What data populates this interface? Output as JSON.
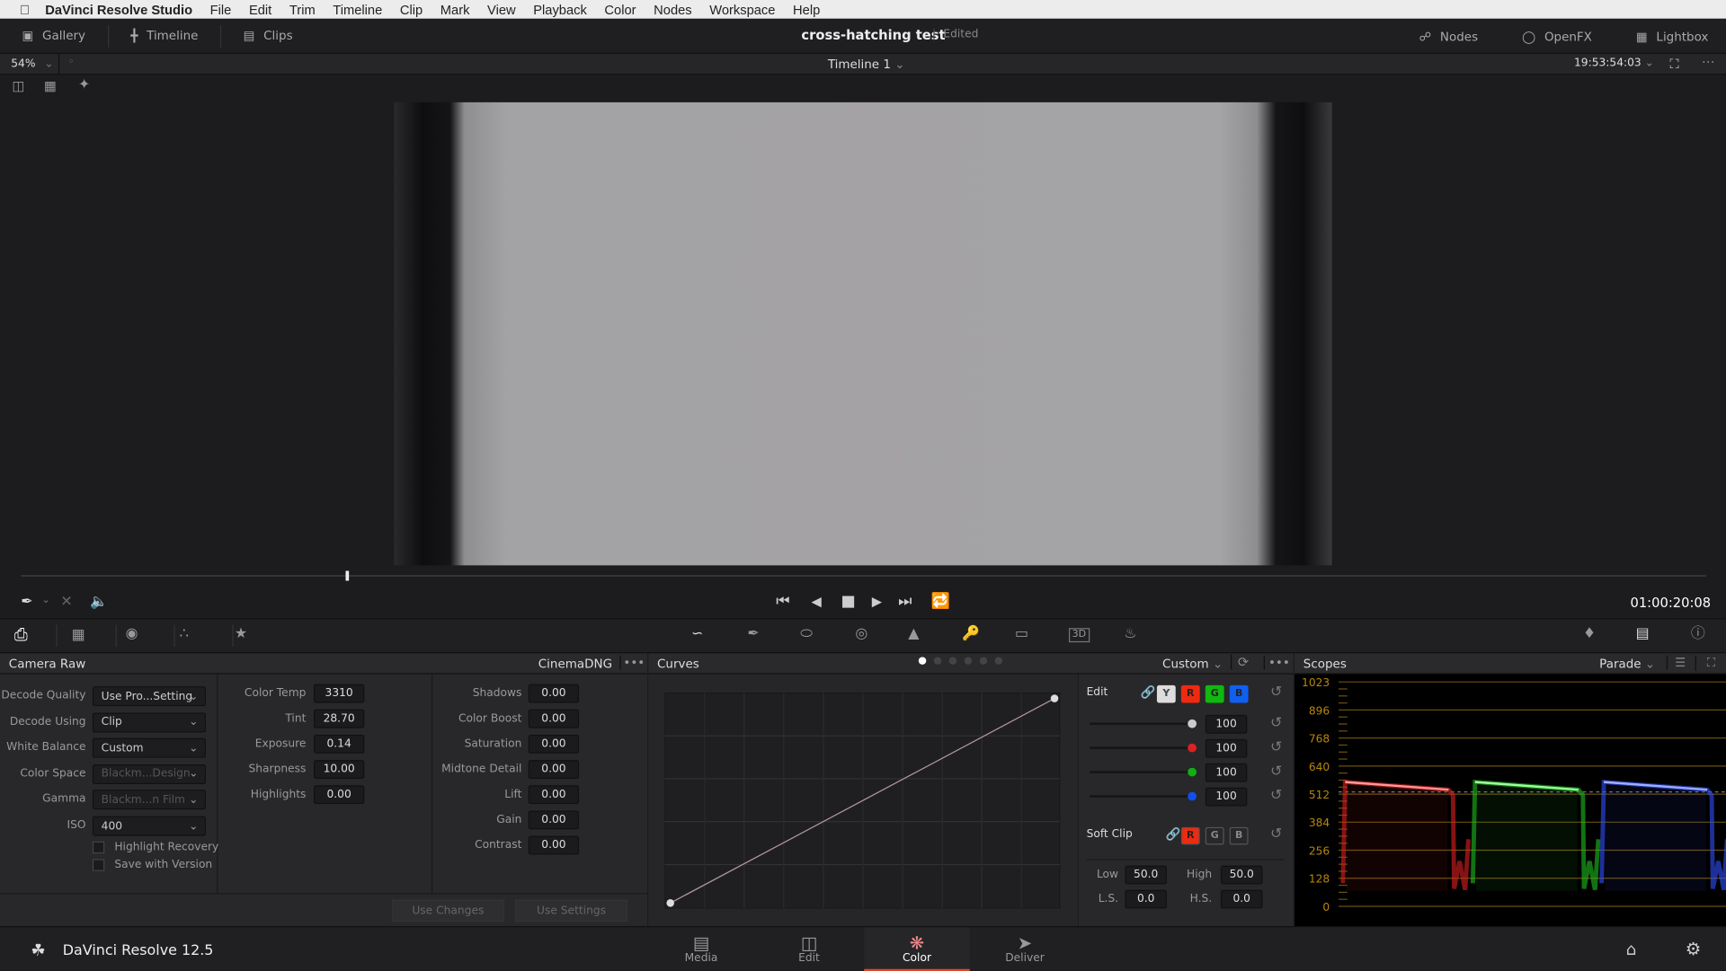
{
  "menubar": {
    "apple": "",
    "app": "DaVinci Resolve Studio",
    "items": [
      "File",
      "Edit",
      "Trim",
      "Timeline",
      "Clip",
      "Mark",
      "View",
      "Playback",
      "Color",
      "Nodes",
      "Workspace",
      "Help"
    ]
  },
  "topbar": {
    "left": [
      {
        "label": "Gallery",
        "icon": "gallery-icon"
      },
      {
        "label": "Timeline",
        "icon": "timeline-icon"
      },
      {
        "label": "Clips",
        "icon": "clips-icon"
      }
    ],
    "project": "cross-hatching test",
    "status": "Edited",
    "right": [
      {
        "label": "Nodes",
        "icon": "nodes-icon"
      },
      {
        "label": "OpenFX",
        "icon": "openfx-icon"
      },
      {
        "label": "Lightbox",
        "icon": "lightbox-icon"
      }
    ]
  },
  "viewer": {
    "zoom": "54%",
    "timeline": "Timeline 1",
    "source_timecode": "19:53:54:03",
    "timecode": "01:00:20:08",
    "playhead": 0.193
  },
  "camera_raw": {
    "title": "Camera Raw",
    "format": "CinemaDNG",
    "dropdowns": [
      {
        "label": "Decode Quality",
        "value": "Use Pro...Setting",
        "enabled": true
      },
      {
        "label": "Decode Using",
        "value": "Clip",
        "enabled": true
      },
      {
        "label": "White Balance",
        "value": "Custom",
        "enabled": true
      },
      {
        "label": "Color Space",
        "value": "Blackm...Design",
        "enabled": false
      },
      {
        "label": "Gamma",
        "value": "Blackm...n Film",
        "enabled": false
      },
      {
        "label": "ISO",
        "value": "400",
        "enabled": true
      }
    ],
    "checkboxes": [
      {
        "label": "Highlight Recovery",
        "checked": false
      },
      {
        "label": "Save with Version",
        "checked": false
      }
    ],
    "col2": [
      {
        "label": "Color Temp",
        "value": "3310"
      },
      {
        "label": "Tint",
        "value": "28.70"
      },
      {
        "label": "Exposure",
        "value": "0.14"
      },
      {
        "label": "Sharpness",
        "value": "10.00"
      },
      {
        "label": "Highlights",
        "value": "0.00"
      }
    ],
    "col3": [
      {
        "label": "Shadows",
        "value": "0.00"
      },
      {
        "label": "Color Boost",
        "value": "0.00"
      },
      {
        "label": "Saturation",
        "value": "0.00"
      },
      {
        "label": "Midtone Detail",
        "value": "0.00"
      },
      {
        "label": "Lift",
        "value": "0.00"
      },
      {
        "label": "Gain",
        "value": "0.00"
      },
      {
        "label": "Contrast",
        "value": "0.00"
      }
    ],
    "buttons": {
      "use_changes": "Use Changes",
      "use_settings": "Use Settings"
    }
  },
  "curves": {
    "title": "Curves",
    "preset": "Custom",
    "edit_label": "Edit",
    "channels": [
      "Y",
      "R",
      "G",
      "B"
    ],
    "channel_colors": {
      "Y": "#dddddd",
      "R": "#ee2a10",
      "G": "#10b810",
      "B": "#1060f0"
    },
    "intensity": [
      {
        "channel": "Y",
        "value": "100",
        "color": "#cccccc"
      },
      {
        "channel": "R",
        "value": "100",
        "color": "#dd2020"
      },
      {
        "channel": "G",
        "value": "100",
        "color": "#10b010"
      },
      {
        "channel": "B",
        "value": "100",
        "color": "#1050ee"
      }
    ],
    "soft_clip": {
      "label": "Soft Clip",
      "channels": [
        "R",
        "G",
        "B"
      ],
      "low_label": "Low",
      "low": "50.0",
      "high_label": "High",
      "high": "50.0",
      "ls_label": "L.S.",
      "ls": "0.0",
      "hs_label": "H.S.",
      "hs": "0.0"
    }
  },
  "scopes": {
    "title": "Scopes",
    "mode": "Parade",
    "ticks": [
      "1023",
      "896",
      "768",
      "640",
      "512",
      "384",
      "256",
      "128",
      "0"
    ],
    "accent": "#b8860b"
  },
  "bottom": {
    "app": "DaVinci Resolve 12.5",
    "pages": [
      {
        "label": "Media",
        "icon": "media-icon"
      },
      {
        "label": "Edit",
        "icon": "edit-icon"
      },
      {
        "label": "Color",
        "icon": "color-icon",
        "active": true
      },
      {
        "label": "Deliver",
        "icon": "deliver-icon"
      }
    ]
  }
}
